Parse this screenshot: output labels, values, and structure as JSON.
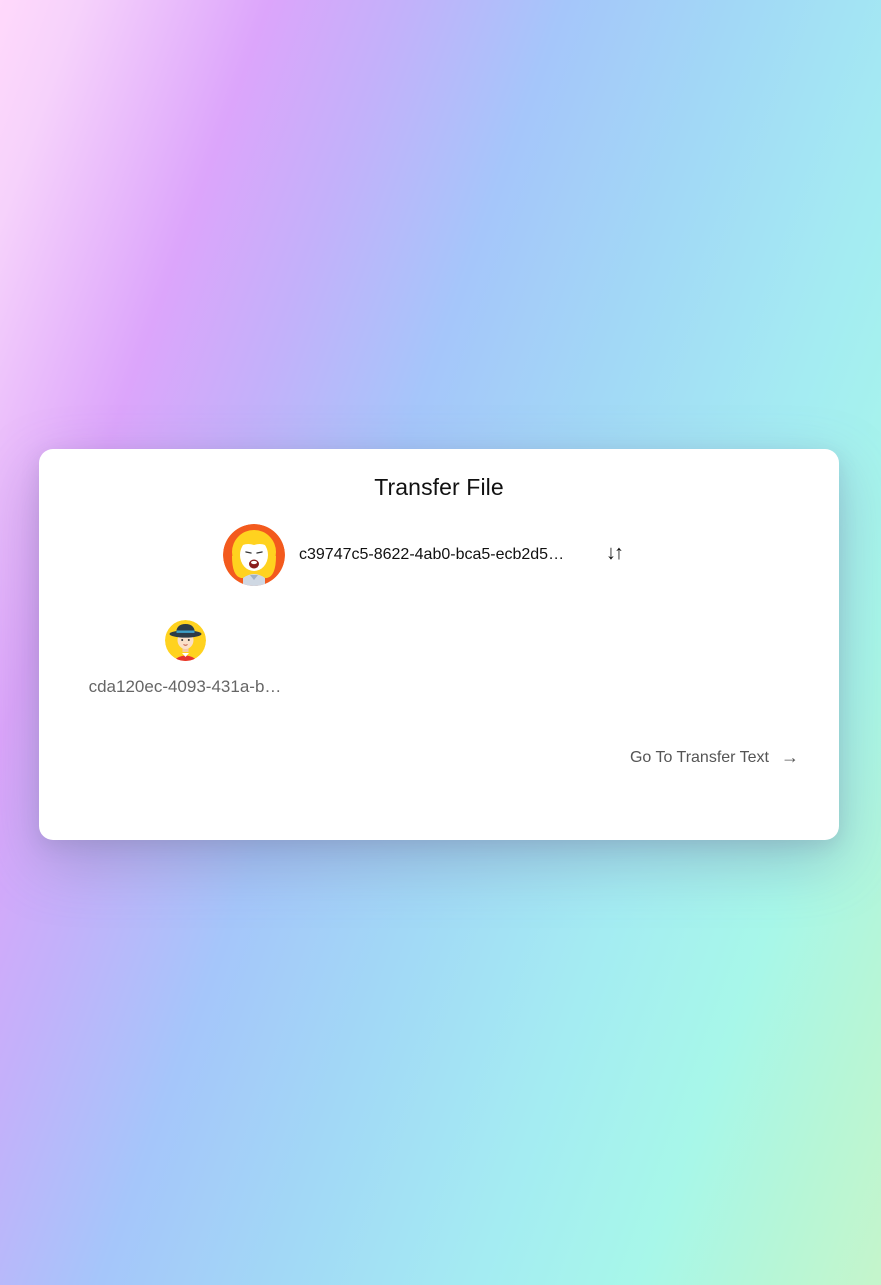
{
  "card": {
    "title": "Transfer File"
  },
  "self": {
    "id": "c39747c5-8622-4ab0-bca5-ecb2d5…",
    "avatar_icon": "woman-avatar-icon",
    "swap_icon": "↓↑"
  },
  "peers": [
    {
      "id": "cda120ec-4093-431a-b…",
      "avatar_icon": "man-hat-avatar-icon"
    }
  ],
  "navigation": {
    "link_label": "Go To Transfer Text",
    "link_icon": "→"
  }
}
